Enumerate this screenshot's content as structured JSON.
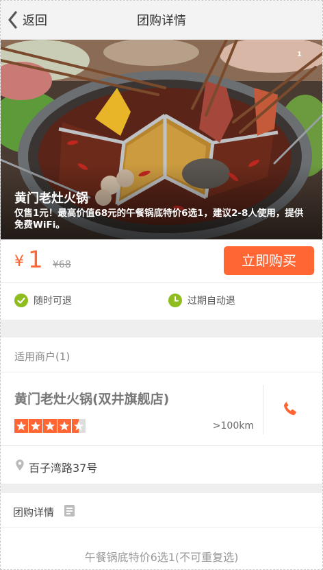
{
  "header": {
    "back_label": "返回",
    "title": "团购详情"
  },
  "hero": {
    "pager": "1",
    "title": "黄门老灶火锅",
    "description": "仅售1元！最高价值68元的午餐锅底特价6选1，建议2-8人使用，提供免费WiFi。"
  },
  "price": {
    "currency": "¥",
    "current": "1",
    "original": "¥68",
    "buy_label": "立即购买"
  },
  "guarantees": [
    "随时可退",
    "过期自动退"
  ],
  "merchant_section": {
    "title": "适用商户(1)",
    "name": "黄门老灶火锅(双井旗舰店)",
    "rating": 4.5,
    "rating_max": 5,
    "distance": ">100km",
    "address": "百子湾路37号"
  },
  "detail": {
    "title": "团购详情",
    "item": "午餐锅底特价6选1(不可重复选)"
  },
  "colors": {
    "accent": "#ff6633",
    "guarantee_green": "#8fbc1e"
  }
}
